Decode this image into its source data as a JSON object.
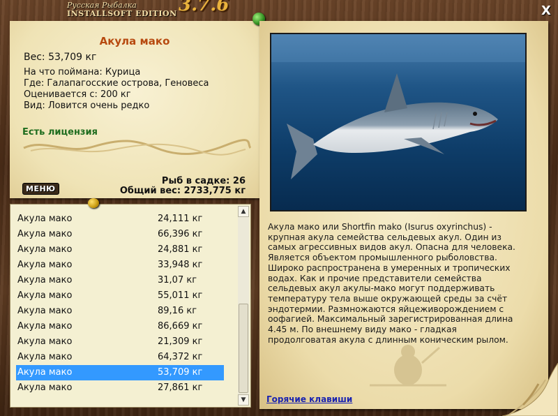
{
  "app": {
    "title_line1": "Русская Рыбалка",
    "title_line2": "INSTALLSOFT EDITION",
    "version": "3.7.6",
    "close_label": "X"
  },
  "catch": {
    "name": "Акула мако",
    "weight": "Вес: 53,709 кг",
    "bait": "На что поймана: Курица",
    "location": "Где: Галапагосские острова, Геновеса",
    "price": "Оценивается с: 200 кг",
    "rarity": "Вид: Ловится очень редко",
    "license": "Есть лицензия"
  },
  "keepnet": {
    "count": "Рыб в садке: 26",
    "total_weight": "Общий вес: 2733,775 кг"
  },
  "menu_label": "МЕНЮ",
  "fish_list": [
    {
      "name": "Акула мако",
      "weight": "24,111 кг"
    },
    {
      "name": "Акула мако",
      "weight": "66,396 кг"
    },
    {
      "name": "Акула мако",
      "weight": "24,881 кг"
    },
    {
      "name": "Акула мако",
      "weight": "33,948 кг"
    },
    {
      "name": "Акула мако",
      "weight": "31,07 кг"
    },
    {
      "name": "Акула мако",
      "weight": "55,011 кг"
    },
    {
      "name": "Акула мако",
      "weight": "89,16 кг"
    },
    {
      "name": "Акула мако",
      "weight": "86,669 кг"
    },
    {
      "name": "Акула мако",
      "weight": "21,309 кг"
    },
    {
      "name": "Акула мако",
      "weight": "64,372 кг"
    },
    {
      "name": "Акула мако",
      "weight": "53,709 кг",
      "selected": true
    },
    {
      "name": "Акула мако",
      "weight": "27,861 кг"
    }
  ],
  "description": "Акула мако или Shortfin mako (Isurus oxyrinchus) - крупная акула семейства сельдевых акул. Один из самых агрессивных видов акул. Опасна для человека. Является объектом промышленного рыболовства. Широко распространена в умеренных и тропических водах. Как и прочие представители семейства сельдевых акул акулы-мако могут поддерживать температуру тела выше окружающей среды за счёт эндотермии. Размножаются яйцеживорождением с оофагией. Максимальный зарегистрированная длина 4.45 м. По внешнему виду мако - гладкая продолговатая акула с длинным коническим рылом.",
  "hotkeys_label": "Горячие клавиши",
  "colors": {
    "title_orange": "#b74a10",
    "license_green": "#1f6d1f",
    "selection_blue": "#3399ff",
    "link_blue": "#1a23b0",
    "version_gold": "#e9b23c"
  }
}
